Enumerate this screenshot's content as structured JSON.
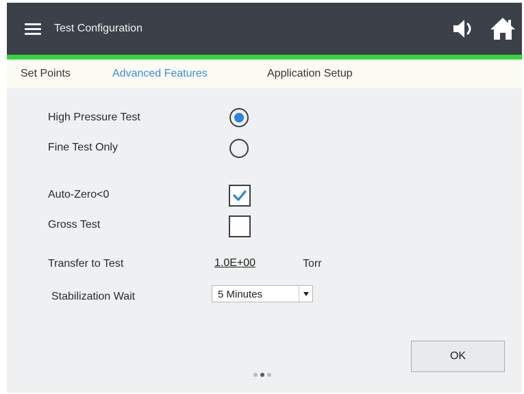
{
  "header": {
    "title": "Test Configuration",
    "menu_icon": "hamburger-menu-icon",
    "speaker_icon": "speaker-icon",
    "home_icon": "home-icon",
    "bar_color": "#3c4149",
    "accent_color": "#36d63d"
  },
  "tabs": [
    {
      "label": "Set Points",
      "active": false
    },
    {
      "label": "Advanced Features",
      "active": true
    },
    {
      "label": "Application Setup",
      "active": false
    }
  ],
  "tab_active_color": "#3a8fdc",
  "options": {
    "high_pressure_test": {
      "label": "High Pressure Test",
      "selected": true
    },
    "fine_test_only": {
      "label": "Fine Test Only",
      "selected": false
    },
    "auto_zero": {
      "label": "Auto-Zero<0",
      "checked": true
    },
    "gross_test": {
      "label": "Gross Test",
      "checked": false
    }
  },
  "transfer": {
    "label": "Transfer to Test",
    "value": "1.0E+00",
    "unit": "Torr"
  },
  "stabilization": {
    "label": "Stabilization Wait",
    "selected": "5 Minutes"
  },
  "pager": {
    "pages": 3,
    "current": 2
  },
  "ok_button": {
    "label": "OK"
  }
}
